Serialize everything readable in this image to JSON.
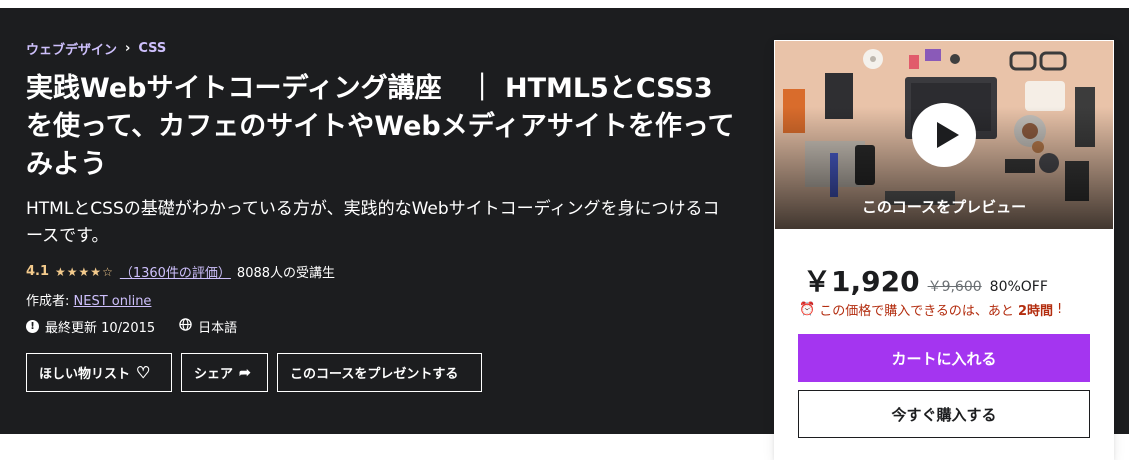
{
  "breadcrumb": [
    "ウェブデザイン",
    "CSS"
  ],
  "breadcrumb_separator": "›",
  "title": "実践Webサイトコーディング講座　｜ HTML5とCSS3を使って、カフェのサイトやWebメディアサイトを作ってみよう",
  "subtitle": "HTMLとCSSの基礎がわかっている方が、実践的なWebサイトコーディングを身につけるコースです。",
  "rating": {
    "score": "4.1",
    "stars_text": "★★★★☆",
    "value": 4.1,
    "count_link": "（1360件の評価）",
    "students": "8088人の受講生"
  },
  "author": {
    "prefix": "作成者: ",
    "name": "NEST online"
  },
  "meta": {
    "updated": "最終更新 10/2015",
    "language": "日本語",
    "updated_icon": "alert-icon",
    "language_icon": "globe-icon"
  },
  "buttons": {
    "wishlist": "ほしい物リスト",
    "wishlist_icon": "♡",
    "share": "シェア",
    "share_icon": "➦",
    "gift": "このコースをプレゼントする"
  },
  "card": {
    "preview_label": "このコースをプレビュー",
    "price": "￥1,920",
    "original_price": "￥9,600",
    "discount": "80%OFF",
    "timer_icon": "⏰",
    "timer_text": "この価格で購入できるのは、あと",
    "timer_bold": "2時間",
    "timer_suffix": "!",
    "cart_button": "カートに入れる",
    "buy_button": "今すぐ購入する"
  },
  "colors": {
    "hero_bg": "#1c1d1f",
    "accent_purple": "#a435f0",
    "link_purple": "#cec0fc",
    "star": "#f3ca8c",
    "urgency": "#b32d0f"
  }
}
